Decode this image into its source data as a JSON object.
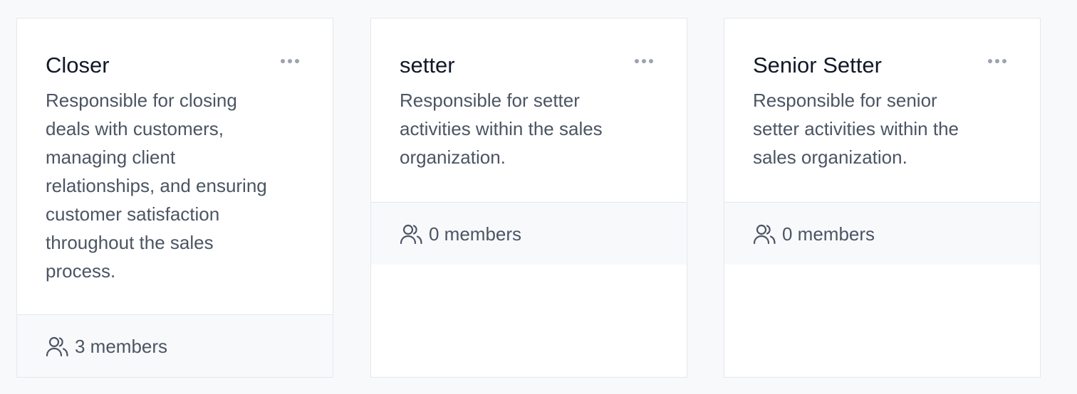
{
  "roles": [
    {
      "title": "Closer",
      "description": "Responsible for closing deals with customers, managing client relationships, and ensuring customer satisfaction throughout the sales process.",
      "members": "3 members",
      "menu_icon": "ellipsis-horizontal-icon",
      "members_icon": "users-icon"
    },
    {
      "title": "setter",
      "description": "Responsible for setter activities within the sales organization.",
      "members": "0 members",
      "menu_icon": "ellipsis-horizontal-icon",
      "members_icon": "users-icon"
    },
    {
      "title": "Senior Setter",
      "description": "Responsible for senior setter activities within the sales organization.",
      "members": "0 members",
      "menu_icon": "ellipsis-horizontal-icon",
      "members_icon": "users-icon"
    }
  ],
  "colors": {
    "background": "#f8f9fb",
    "card": "#ffffff",
    "border": "#e5e7eb",
    "title": "#111827",
    "text": "#4b5563",
    "icon": "#9ca3af"
  }
}
